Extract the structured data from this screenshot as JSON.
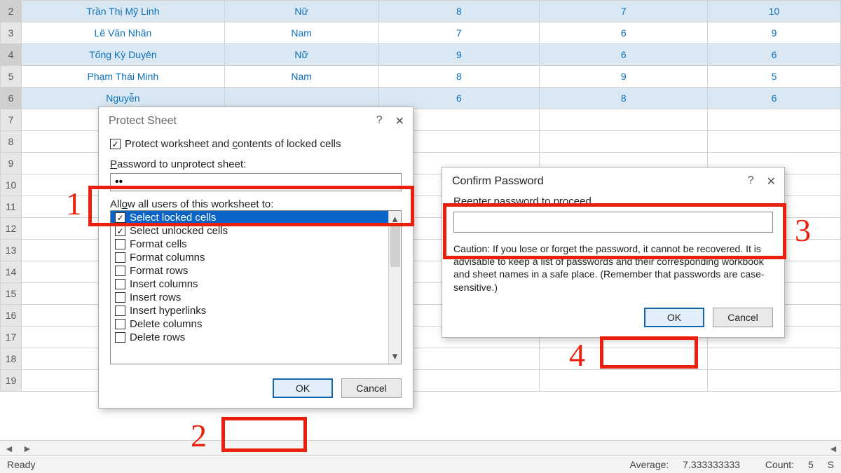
{
  "sheet": {
    "rows": [
      {
        "n": "2",
        "sel": true,
        "b": "Trần Thị Mỹ Linh",
        "c": "Nữ",
        "d": "8",
        "e": "7",
        "f": "10"
      },
      {
        "n": "3",
        "sel": false,
        "b": "Lê Văn Nhân",
        "c": "Nam",
        "d": "7",
        "e": "6",
        "f": "9"
      },
      {
        "n": "4",
        "sel": true,
        "b": "Tống Kỳ Duyên",
        "c": "Nữ",
        "d": "9",
        "e": "6",
        "f": "6"
      },
      {
        "n": "5",
        "sel": false,
        "b": "Phạm Thái Minh",
        "c": "Nam",
        "d": "8",
        "e": "9",
        "f": "5"
      },
      {
        "n": "6",
        "sel": true,
        "b": "Nguyễn",
        "c": "",
        "d": "6",
        "e": "8",
        "f": "6"
      },
      {
        "n": "7",
        "sel": false
      },
      {
        "n": "8",
        "sel": false
      },
      {
        "n": "9",
        "sel": false
      },
      {
        "n": "10",
        "sel": false
      },
      {
        "n": "11",
        "sel": false
      },
      {
        "n": "12",
        "sel": false
      },
      {
        "n": "13",
        "sel": false
      },
      {
        "n": "14",
        "sel": false
      },
      {
        "n": "15",
        "sel": false
      },
      {
        "n": "16",
        "sel": false
      },
      {
        "n": "17",
        "sel": false
      },
      {
        "n": "18",
        "sel": false
      },
      {
        "n": "19",
        "sel": false
      }
    ]
  },
  "status": {
    "ready": "Ready",
    "average_label": "Average:",
    "average_value": "7.333333333",
    "count_label": "Count:",
    "count_value": "5",
    "sum_label": "S"
  },
  "dlg1": {
    "title": "Protect Sheet",
    "help": "?",
    "close": "✕",
    "protect_label_pre": "Protect worksheet and ",
    "protect_label_u": "c",
    "protect_label_post": "ontents of locked cells",
    "pwd_label_pre": "",
    "pwd_label_u": "P",
    "pwd_label_post": "assword to unprotect sheet:",
    "pwd_value": "••",
    "allow_label_pre": "All",
    "allow_label_u": "o",
    "allow_label_post": "w all users of this worksheet to:",
    "items": [
      {
        "checked": true,
        "sel": true,
        "label": "Select locked cells"
      },
      {
        "checked": true,
        "sel": false,
        "label": "Select unlocked cells"
      },
      {
        "checked": false,
        "sel": false,
        "label": "Format cells"
      },
      {
        "checked": false,
        "sel": false,
        "label": "Format columns"
      },
      {
        "checked": false,
        "sel": false,
        "label": "Format rows"
      },
      {
        "checked": false,
        "sel": false,
        "label": "Insert columns"
      },
      {
        "checked": false,
        "sel": false,
        "label": "Insert rows"
      },
      {
        "checked": false,
        "sel": false,
        "label": "Insert hyperlinks"
      },
      {
        "checked": false,
        "sel": false,
        "label": "Delete columns"
      },
      {
        "checked": false,
        "sel": false,
        "label": "Delete rows"
      }
    ],
    "ok": "OK",
    "cancel": "Cancel"
  },
  "dlg2": {
    "title": "Confirm Password",
    "help": "?",
    "close": "✕",
    "reenter_u": "R",
    "reenter_post": "eenter password to proceed.",
    "value": "",
    "caution": "Caution: If you lose or forget the password, it cannot be recovered. It is advisable to keep a list of passwords and their corresponding workbook and sheet names in a safe place.  (Remember that passwords are case-sensitive.)",
    "ok": "OK",
    "cancel": "Cancel"
  },
  "ann": {
    "n1": "1",
    "n2": "2",
    "n3": "3",
    "n4": "4"
  }
}
